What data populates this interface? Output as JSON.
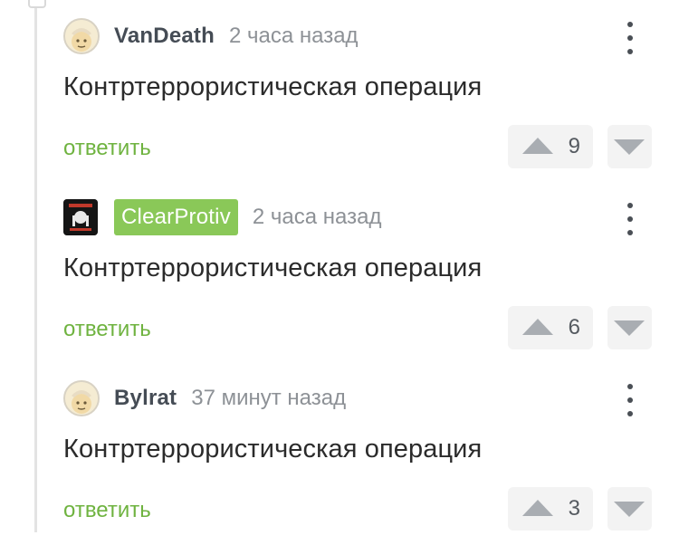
{
  "comments": [
    {
      "author": "VanDeath",
      "time": "2 часа назад",
      "text": "Контртеррористическая операция",
      "reply_label": "ответить",
      "score": "9",
      "avatar": "default-avatar"
    },
    {
      "author": "ClearProtiv",
      "time": "2 часа назад",
      "text": "Контртеррористическая операция",
      "reply_label": "ответить",
      "score": "6",
      "avatar": "custom-avatar",
      "author_badge_color": "#8ac858"
    },
    {
      "author": "Bylrat",
      "time": "37 минут назад",
      "text": "Контртеррористическая операция",
      "reply_label": "ответить",
      "score": "3",
      "avatar": "default-avatar"
    }
  ],
  "colors": {
    "reply": "#6fb340",
    "badge": "#8ac858",
    "vote_bg": "#f3f3f3",
    "vote_arrow": "#a9adb2"
  },
  "icons": [
    "more-vertical-icon",
    "upvote-arrow-icon",
    "downvote-arrow-icon"
  ]
}
